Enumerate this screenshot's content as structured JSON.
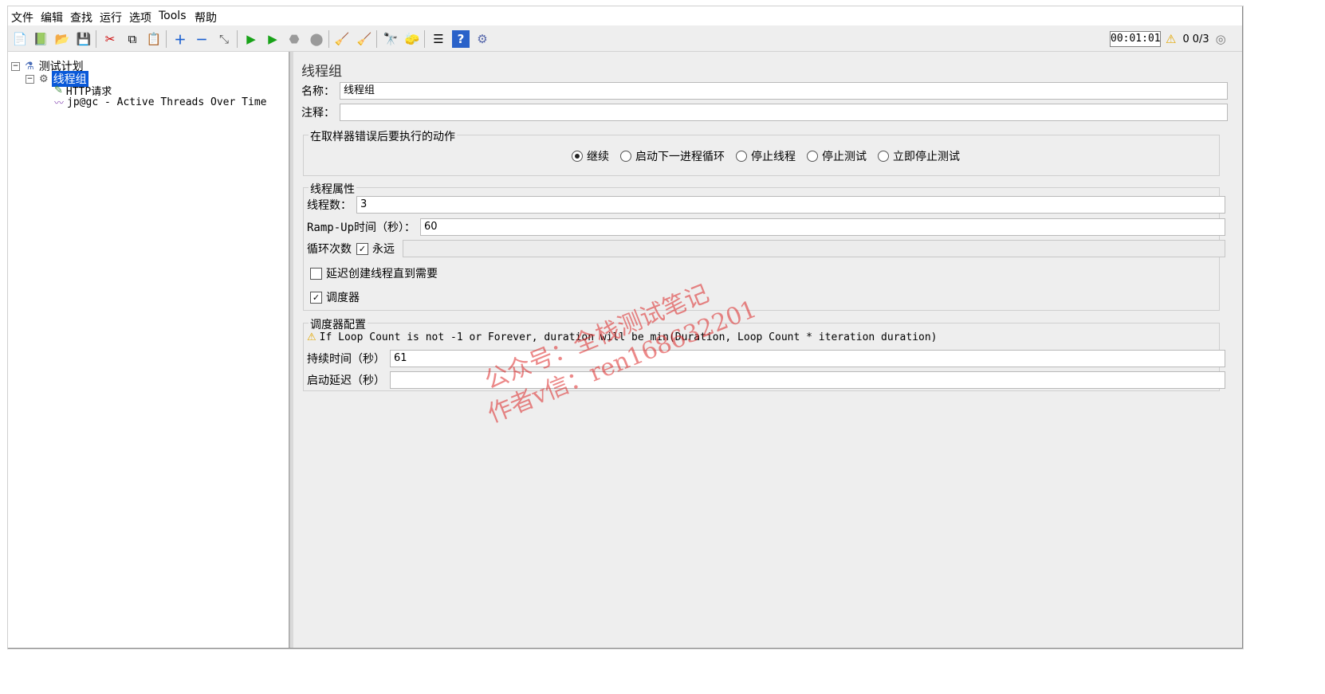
{
  "menu": [
    "文件",
    "编辑",
    "查找",
    "运行",
    "选项",
    "Tools",
    "帮助"
  ],
  "toolbar": {
    "timer": "00:01:01",
    "warn_count": "0",
    "threads": "0/3"
  },
  "tree": {
    "items": [
      {
        "label": "测试计划"
      },
      {
        "label": "线程组"
      },
      {
        "label": "HTTP请求"
      },
      {
        "label": "jp@gc - Active Threads Over Time"
      }
    ]
  },
  "panel": {
    "title": "线程组",
    "name_label": "名称：",
    "name_value": "线程组",
    "comment_label": "注释：",
    "comment_value": "",
    "error_group": {
      "legend": "在取样器错误后要执行的动作",
      "options": [
        "继续",
        "启动下一进程循环",
        "停止线程",
        "停止测试",
        "立即停止测试"
      ],
      "selected": "继续"
    },
    "thread_props": {
      "legend": "线程属性",
      "threads_label": "线程数：",
      "threads_value": "3",
      "rampup_label": "Ramp-Up时间（秒）：",
      "rampup_value": "60",
      "loop_label": "循环次数",
      "forever_label": "永远",
      "forever_checked": true,
      "loop_value": "",
      "delay_label": "延迟创建线程直到需要",
      "delay_checked": false,
      "scheduler_label": "调度器",
      "scheduler_checked": true
    },
    "scheduler": {
      "legend": "调度器配置",
      "warning": "If Loop Count is not -1 or Forever, duration will be min(Duration, Loop Count * iteration duration)",
      "duration_label": "持续时间（秒）",
      "duration_value": "61",
      "delay_label": "启动延迟（秒）",
      "delay_value": ""
    }
  },
  "watermark": {
    "line1": "公众号：全栈测试笔记",
    "line2": "作者v信：ren168632201"
  },
  "colors": {
    "selection": "#0a59d9",
    "watermark": "#dc2828"
  }
}
